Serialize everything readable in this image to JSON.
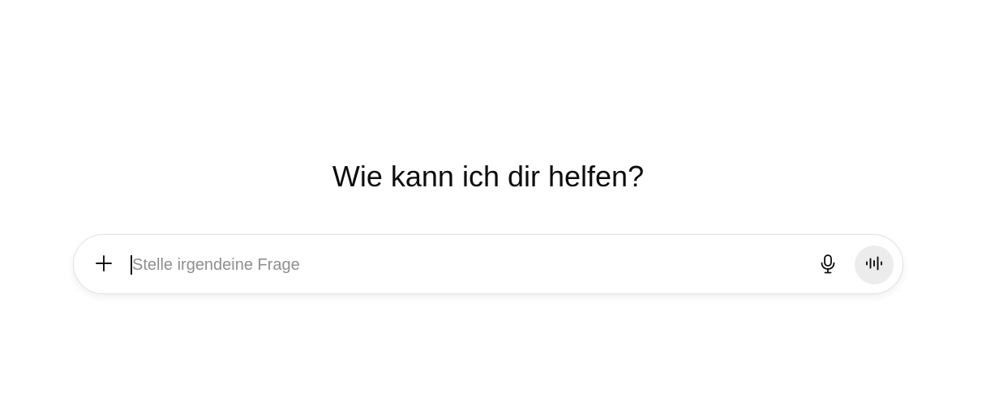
{
  "main": {
    "heading": "Wie kann ich dir helfen?"
  },
  "composer": {
    "placeholder": "Stelle irgendeine Frage",
    "value": "",
    "icons": {
      "add": "plus-icon",
      "dictate": "microphone-icon",
      "voice_mode": "voice-waveform-icon"
    },
    "colors": {
      "text": "#0d0d0d",
      "placeholder": "#8f8f8f",
      "voice_button_bg": "#ececec",
      "border": "#e3e3e3"
    }
  }
}
